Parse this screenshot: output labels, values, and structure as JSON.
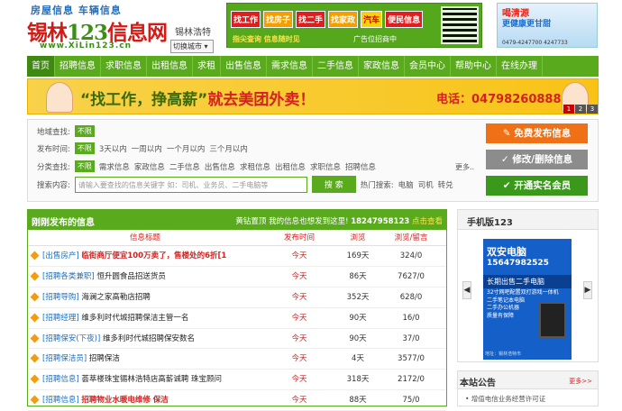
{
  "header": {
    "logo_top": "房屋信息  车辆信息",
    "logo_main_a": "锡林",
    "logo_main_b": "123",
    "logo_main_c": "信息网",
    "logo_url": "www.XiLin123.cn",
    "city_name": "锡林浩特",
    "city_select": "切换城市 ▾",
    "ad1_buttons": [
      "找工作",
      "找房子",
      "找二手",
      "找家政",
      "汽车",
      "便民信息"
    ],
    "ad1_sub": "指尖查询 信息随时见",
    "ad1_sub2": "广告位招商中",
    "ad2_a": "喝清源",
    "ad2_b": "更健康更甘甜",
    "ad2_c": "0479-4247700 4247733"
  },
  "nav": {
    "items": [
      "首页",
      "招聘信息",
      "求职信息",
      "出租信息",
      "求租",
      "出售信息",
      "需求信息",
      "二手信息",
      "家政信息",
      "会员中心",
      "帮助中心",
      "在线办理"
    ]
  },
  "banner": {
    "slogan_a": "“找工作，挣高薪”",
    "slogan_b": "就去美团外卖！",
    "tel": "电话：04798260888",
    "pager": [
      "1",
      "2",
      "3"
    ]
  },
  "search": {
    "region_label": "地域查找:",
    "region_tag": "不限",
    "time_label": "发布时间:",
    "time_tag": "不限",
    "time_opts": [
      "3天以内",
      "一周以内",
      "一个月以内",
      "三个月以内"
    ],
    "cat_label": "分类查找:",
    "cat_tag": "不限",
    "cat_opts": [
      "需求信息",
      "家政信息",
      "二手信息",
      "出售信息",
      "求租信息",
      "出租信息",
      "求职信息",
      "招聘信息"
    ],
    "more": "更多..",
    "content_label": "搜索内容:",
    "placeholder": "请输入要查找的信息关键字 如：司机、业务员、二手电脑等",
    "button": "搜 索",
    "hot_label": "热门搜索:",
    "hot": [
      "电脑",
      "司机",
      "转兑"
    ]
  },
  "actions": {
    "publish": "免费发布信息",
    "edit": "修改/删除信息",
    "member": "开通实名会员"
  },
  "listings": {
    "title": "刚刚发布的信息",
    "right_a": "黄钻置顶 我的信息也想发到这里!",
    "right_tel": "18247958123",
    "right_link": "点击查看",
    "columns": [
      "信息标题",
      "发布时间",
      "浏览",
      "浏览/留言"
    ],
    "rows": [
      {
        "cat": "[出售房产]",
        "title": "临街商厅便宜100万卖了，售楼处的6折[1",
        "hot": true,
        "time": "今天",
        "views": "169天",
        "comments": "324/0"
      },
      {
        "cat": "[招聘各类兼职]",
        "title": "恒升圆食品招送货员",
        "hot": false,
        "time": "今天",
        "views": "86天",
        "comments": "7627/0"
      },
      {
        "cat": "[招聘导购]",
        "title": "海澜之家高勒店招聘",
        "hot": false,
        "time": "今天",
        "views": "352天",
        "comments": "628/0"
      },
      {
        "cat": "[招聘经理]",
        "title": "维多利时代城招聘保洁主管一名",
        "hot": false,
        "time": "今天",
        "views": "90天",
        "comments": "16/0"
      },
      {
        "cat": "[招聘保安(下夜)]",
        "title": "维多利时代城招聘保安数名",
        "hot": false,
        "time": "今天",
        "views": "90天",
        "comments": "37/0"
      },
      {
        "cat": "[招聘保洁员]",
        "title": "招聘保洁",
        "hot": false,
        "time": "今天",
        "views": "4天",
        "comments": "3577/0"
      },
      {
        "cat": "[招聘信息]",
        "title": "荟萃楼珠宝锡林浩特店高薪诚聘 珠宝顾问",
        "hot": false,
        "time": "今天",
        "views": "318天",
        "comments": "2172/0"
      },
      {
        "cat": "[招聘信息]",
        "title": "招聘物业水暖电维修 保洁",
        "hot": true,
        "time": "今天",
        "views": "88天",
        "comments": "75/0"
      }
    ]
  },
  "mobile": {
    "title": "手机版123",
    "ad_n1": "双安电脑",
    "ad_n2": "15647982525",
    "ad_n3": "长期出售二手电脑",
    "ad_n4": "32寸网吧配置双打游戏一体机\n二手笔记本电脑\n二手办公机器\n质量有保障",
    "ad_n5": "地址：锡林浩特市"
  },
  "notice": {
    "title": "本站公告",
    "more": "更多>>",
    "first": "• 增值电信业务经营许可证"
  }
}
